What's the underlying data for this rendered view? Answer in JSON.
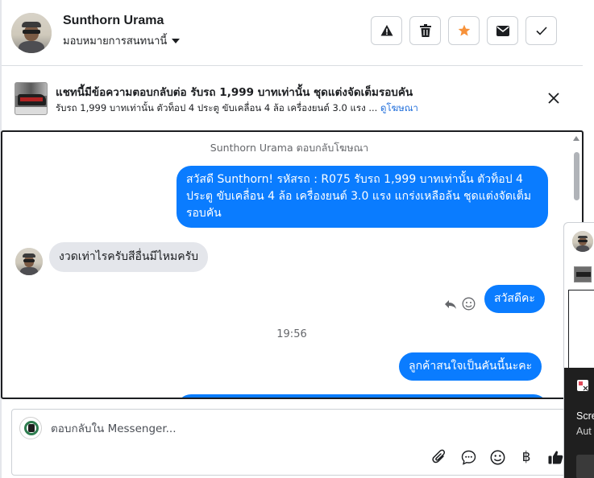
{
  "header": {
    "contact_name": "Sunthorn Urama",
    "assign_label": "มอบหมายการสนทนานี้",
    "actions": [
      {
        "name": "report-spam-button",
        "icon": "alert-triangle-icon"
      },
      {
        "name": "delete-button",
        "icon": "trash-icon"
      },
      {
        "name": "star-button",
        "icon": "star-icon",
        "color": "#f7923a"
      },
      {
        "name": "mark-unread-button",
        "icon": "envelope-icon"
      },
      {
        "name": "mark-done-button",
        "icon": "check-icon"
      }
    ]
  },
  "ad_banner": {
    "title": "แชทนี้มีข้อความตอบกลับต่อ รับรถ 1,999 บาทเท่านั้น ชุดแต่งจัดเต็มรอบคัน",
    "subtitle": "รับรถ 1,999 บาทเท่านั้น ตัวท็อป 4 ประตู ขับเคลื่อน 4 ล้อ เครื่องยนต์ 3.0 แรง ...",
    "link_label": "ดูโฆษณา"
  },
  "messages": {
    "reply_note": "Sunthorn Urama ตอบกลับโฆษณา",
    "outgoing_1": "สวัสดี Sunthorn! รหัสรถ : R075 รับรถ 1,999 บาทเท่านั้น ตัวท็อป 4 ประตู ขับเคลื่อน 4 ล้อ  เครื่องยนต์ 3.0 แรง แกร่งเหลือล้น ชุดแต่งจัดเต็มรอบคัน",
    "incoming_1": "งวดเท่าไรครับสีอื่นมีไหมครับ",
    "outgoing_2": "สวัสดีคะ",
    "time_separator": "19:56",
    "outgoing_3": "ลูกค้าสนใจเป็นคันนี้นะคะ"
  },
  "composer": {
    "placeholder": "ตอบกลับใน Messenger...",
    "currency_symbol": "฿"
  },
  "side_overlay": {
    "text_1": "Scre",
    "text_2": "Aut"
  },
  "colors": {
    "accent": "#0a7cff",
    "link": "#216fdb",
    "star": "#f7923a",
    "bubble_in": "#e4e6eb"
  }
}
